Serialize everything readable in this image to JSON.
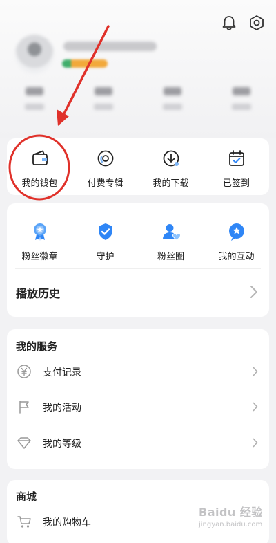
{
  "header": {
    "icons": [
      "bell-icon",
      "settings-hexagon-icon"
    ]
  },
  "quick_actions": [
    {
      "label": "我的钱包",
      "icon": "wallet-icon"
    },
    {
      "label": "付费专辑",
      "icon": "disc-icon"
    },
    {
      "label": "我的下载",
      "icon": "download-icon"
    },
    {
      "label": "已签到",
      "icon": "calendar-check-icon"
    }
  ],
  "fan_items": [
    {
      "label": "粉丝徽章",
      "icon": "medal-icon"
    },
    {
      "label": "守护",
      "icon": "shield-check-icon"
    },
    {
      "label": "粉丝圈",
      "icon": "user-heart-icon"
    },
    {
      "label": "我的互动",
      "icon": "star-bubble-icon"
    }
  ],
  "history": {
    "label": "播放历史"
  },
  "services": {
    "title": "我的服务",
    "items": [
      {
        "label": "支付记录",
        "icon": "yen-circle-icon"
      },
      {
        "label": "我的活动",
        "icon": "flag-icon"
      },
      {
        "label": "我的等级",
        "icon": "diamond-icon"
      }
    ]
  },
  "mall": {
    "title": "商城",
    "items": [
      {
        "label": "我的购物车",
        "icon": "shopping-cart-icon"
      }
    ]
  },
  "watermark": {
    "main": "Baidu 经验",
    "sub": "jingyan.baidu.com"
  },
  "colors": {
    "accent_blue": "#2f86f6",
    "annotation_red": "#e0312a"
  }
}
